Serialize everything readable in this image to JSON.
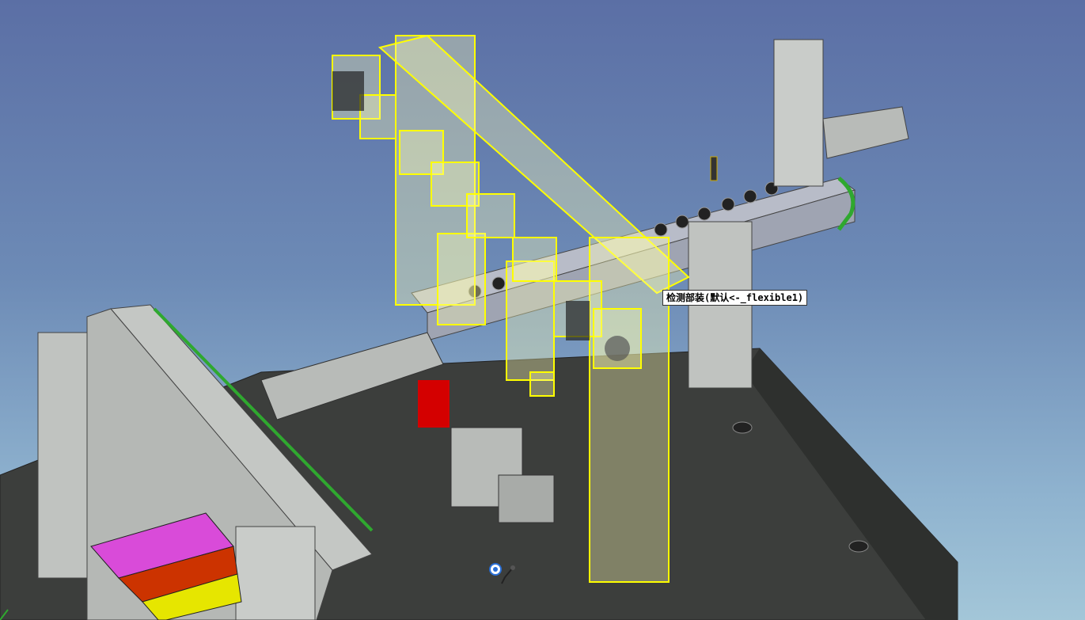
{
  "viewport": {
    "hover_tooltip": "检测部装(默认<-_flexible1)"
  },
  "colors": {
    "background_top": "#5b6fa5",
    "background_bottom": "#a3c6d8",
    "selection_highlight": "#ffff00",
    "base_plate": "#3c3e3c",
    "aluminum": "#c9ccc9",
    "belt_green": "#2fa82f"
  },
  "icons": {
    "cursor": "select-pointer-icon"
  },
  "parts": {
    "color_blocks": [
      "#d94bd9",
      "#cc3300",
      "#e6e600",
      "#2fa82f"
    ]
  }
}
